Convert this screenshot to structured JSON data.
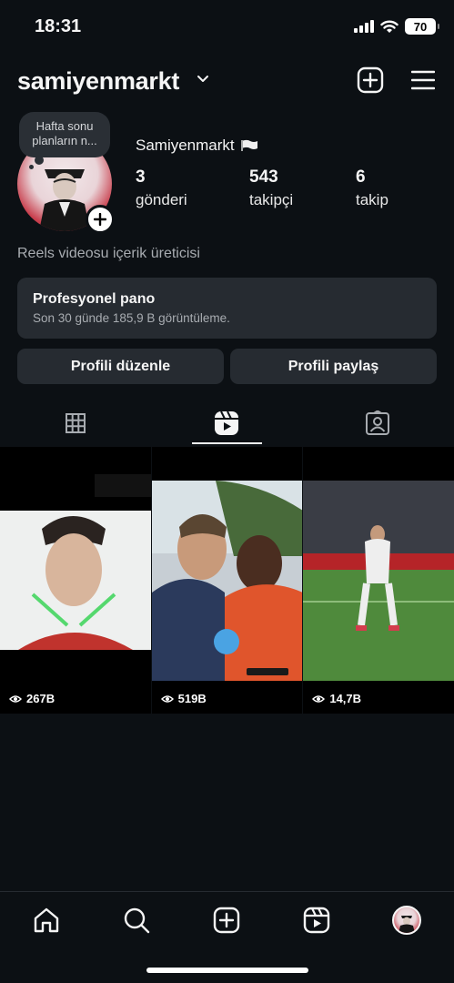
{
  "status_bar": {
    "time": "18:31",
    "battery": "70"
  },
  "header": {
    "username": "samiyenmarkt"
  },
  "profile": {
    "note_text": "Hafta sonu planların n...",
    "display_name": "Samiyenmarkt",
    "stats": [
      {
        "value": "3",
        "label": "gönderi"
      },
      {
        "value": "543",
        "label": "takipçi"
      },
      {
        "value": "6",
        "label": "takip"
      }
    ],
    "bio": "Reels videosu içerik üreticisi"
  },
  "dashboard": {
    "title": "Profesyonel pano",
    "subtitle": "Son 30 günde 185,9 B görüntüleme."
  },
  "buttons": {
    "edit": "Profili düzenle",
    "share": "Profili paylaş"
  },
  "tabs": [
    "grid-icon",
    "reels-icon",
    "tagged-icon"
  ],
  "active_tab": "reels",
  "reels": [
    {
      "views": "267B"
    },
    {
      "views": "519B"
    },
    {
      "views": "14,7B"
    }
  ],
  "bottom_nav": [
    "home-icon",
    "search-icon",
    "create-icon",
    "reels-icon",
    "profile-avatar"
  ],
  "colors": {
    "background": "#0c1014",
    "surface": "#262b31",
    "text": "#f5f5f5",
    "muted": "#a8acb1"
  }
}
